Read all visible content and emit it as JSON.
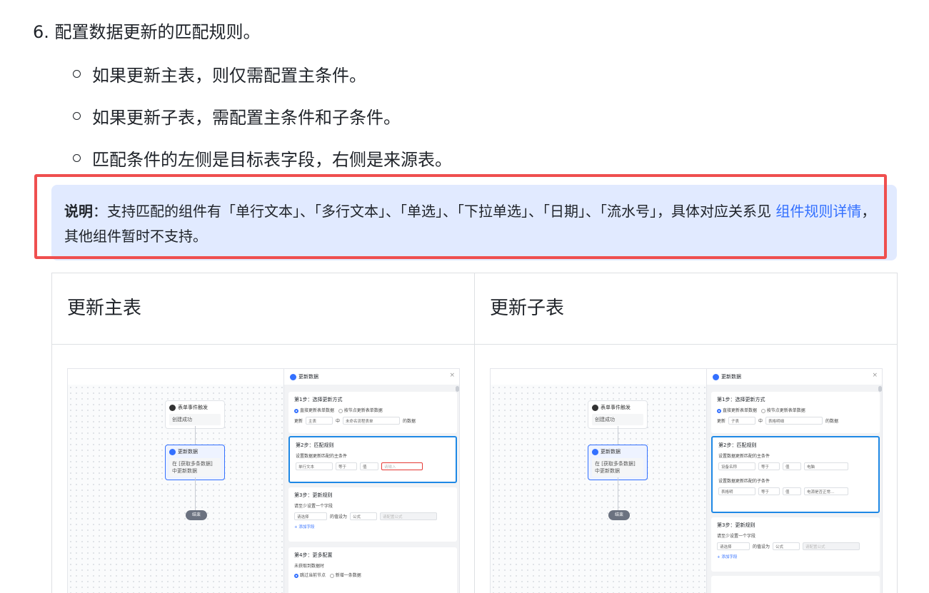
{
  "step_title": "6. 配置数据更新的匹配规则。",
  "bullets": [
    "如果更新主表，则仅需配置主条件。",
    "如果更新子表，需配置主条件和子条件。",
    "匹配条件的左侧是目标表字段，右侧是来源表。"
  ],
  "note": {
    "label": "说明",
    "text": "：支持匹配的组件有「单行文本」、「多行文本」、「单选」、「下拉单选」、「日期」、「流水号」，具体对应关系见",
    "link": "组件规则详情",
    "tail": "，其他组件暂时不支持。"
  },
  "table": {
    "headers": [
      "更新主表",
      "更新子表"
    ]
  },
  "shot_common": {
    "trigger_title": "表单事件触发",
    "trigger_sub": "创建成功",
    "update_title": "更新数据",
    "update_sub": "在 [获取多条数据] 中更新数据",
    "end_label": "结束",
    "panel_title": "更新数据",
    "step1": "第1步：选择更新方式",
    "opt_direct": "直接更新表单数据",
    "opt_node": "按节点更新表单数据",
    "update_label": "更新",
    "in_label": "中",
    "data_suffix": "的数据",
    "step2": "第2步：匹配规则",
    "main_cond": "设置数据更新匹配的主条件",
    "sub_cond": "设置数据更新匹配的子条件",
    "equals": "等于",
    "value": "值",
    "step3": "第3步：更新规则",
    "step3_hint": "请至少设置一个字段",
    "select_placeholder": "请选择",
    "value_set": "的值设为",
    "formula": "公式",
    "formula_placeholder": "请配置公式",
    "add_field": "+ 添加字段",
    "step4": "第4步：更多配置",
    "step4_hint": "未获取到数据时",
    "opt_a": "跳过当前节点",
    "opt_b": "新增一条数据"
  },
  "shot_left": {
    "table_kind": "主表",
    "form_name": "未命名流程表单",
    "field": "单行文本",
    "input_placeholder": "请输入"
  },
  "shot_right": {
    "table_kind": "子表",
    "form_name": "表格明细",
    "field_main": "设备名称",
    "field_main_value": "电脑",
    "field_sub": "表格明",
    "field_sub_value": "电源是否正常..."
  }
}
